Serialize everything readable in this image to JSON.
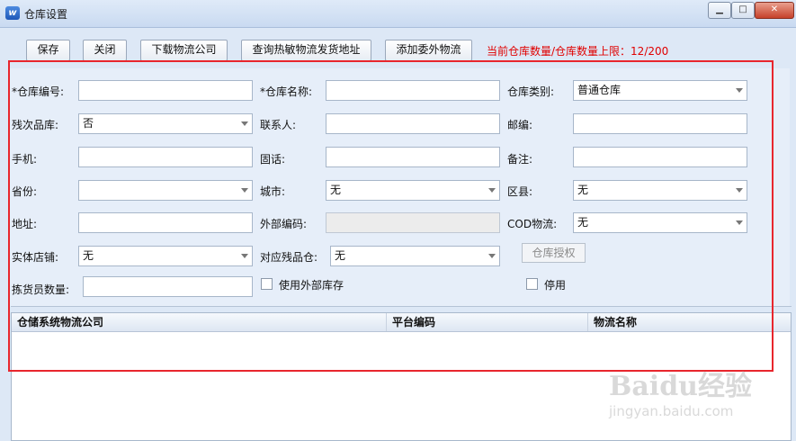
{
  "window": {
    "title": "仓库设置"
  },
  "toolbar": {
    "save": "保存",
    "close": "关闭",
    "download": "下载物流公司",
    "query": "查询热敏物流发货地址",
    "add": "添加委外物流",
    "limit_text": "当前仓库数量/仓库数量上限：12/200"
  },
  "form": {
    "code_label": "*仓库编号:",
    "name_label": "*仓库名称:",
    "type_label": "仓库类别:",
    "type_value": "普通仓库",
    "defect_label": "残次品库:",
    "defect_value": "否",
    "contact_label": "联系人:",
    "zip_label": "邮编:",
    "mobile_label": "手机:",
    "phone_label": "固话:",
    "remark_label": "备注:",
    "province_label": "省份:",
    "city_label": "城市:",
    "city_value": "无",
    "district_label": "区县:",
    "district_value": "无",
    "address_label": "地址:",
    "extcode_label": "外部编码:",
    "cod_label": "COD物流:",
    "cod_value": "无",
    "store_label": "实体店铺:",
    "store_value": "无",
    "defectwh_label": "对应残品仓:",
    "defectwh_value": "无",
    "auth_button": "仓库授权",
    "picker_label": "拣货员数量:",
    "external_stock_label": "使用外部库存",
    "disable_label": "停用"
  },
  "grid": {
    "columns": [
      "仓储系统物流公司",
      "平台编码",
      "物流名称"
    ]
  },
  "watermark": {
    "brand": "Baidu经验",
    "url": "jingyan.baidu.com"
  }
}
